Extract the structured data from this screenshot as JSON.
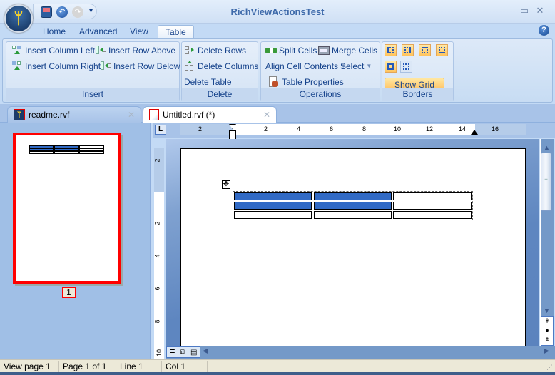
{
  "window": {
    "title": "RichViewActionsTest",
    "controls": {
      "minimize": "–",
      "maximize": "▭",
      "close": "✕"
    }
  },
  "quick_access": [
    {
      "name": "save-icon"
    },
    {
      "name": "undo-icon"
    },
    {
      "name": "redo-icon",
      "disabled": true
    },
    {
      "name": "customize-dropdown-icon",
      "glyph": "▾"
    }
  ],
  "ribbon": {
    "tabs": [
      {
        "label": "Home",
        "active": false
      },
      {
        "label": "Advanced",
        "active": false
      },
      {
        "label": "View",
        "active": false
      },
      {
        "label": "Table",
        "active": true
      }
    ],
    "groups": {
      "insert": {
        "label": "Insert",
        "buttons": [
          "Insert Column Left",
          "Insert Row Above",
          "Insert Column Right",
          "Insert Row Below"
        ]
      },
      "delete": {
        "label": "Delete",
        "buttons": [
          "Delete Rows",
          "Delete Columns",
          "Delete Table"
        ]
      },
      "operations": {
        "label": "Operations",
        "buttons": [
          "Split Cells",
          "Merge Cells",
          "Align Cell Contents",
          "Select",
          "Table Properties"
        ]
      },
      "borders": {
        "label": "Borders",
        "show_grid_lines": "Show Grid Lines",
        "show_grid_lines_active": true
      }
    }
  },
  "doc_tabs": [
    {
      "label": "readme.rvf",
      "active": false
    },
    {
      "label": "Untitled.rvf (*)",
      "active": true
    }
  ],
  "thumbnail": {
    "page_number": "1"
  },
  "ruler": {
    "corner_glyph": "L",
    "h_labels": [
      "2",
      "2",
      "4",
      "6",
      "8",
      "10",
      "12",
      "14",
      "16"
    ],
    "v_labels": [
      "2",
      "2",
      "4",
      "6",
      "8",
      "10"
    ]
  },
  "table": {
    "rows": 3,
    "cols": 3,
    "selected": [
      [
        true,
        true,
        false
      ],
      [
        true,
        true,
        false
      ],
      [
        false,
        false,
        false
      ]
    ],
    "selection_color": "#316ac5"
  },
  "statusbar": {
    "view_page": "View page 1",
    "page_of": "Page 1 of 1",
    "line": "Line 1",
    "col": "Col 1"
  }
}
